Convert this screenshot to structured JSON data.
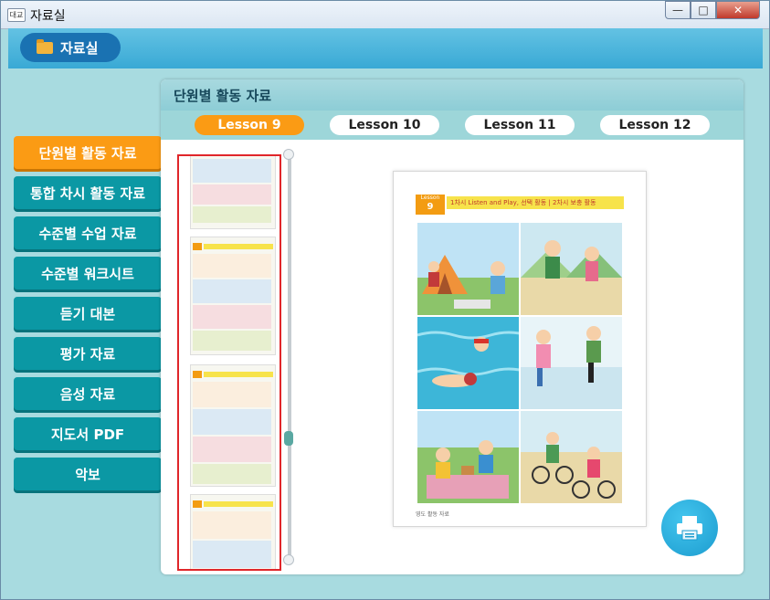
{
  "window": {
    "title": "자료실",
    "app_icon_text": "대교"
  },
  "appbar": {
    "label": "자료실",
    "icon": "folder-icon"
  },
  "sidebar": {
    "items": [
      {
        "label": "단원별 활동 자료",
        "active": true
      },
      {
        "label": "통합 차시 활동 자료",
        "active": false
      },
      {
        "label": "수준별 수업 자료",
        "active": false
      },
      {
        "label": "수준별 워크시트",
        "active": false
      },
      {
        "label": "듣기 대본",
        "active": false
      },
      {
        "label": "평가 자료",
        "active": false
      },
      {
        "label": "음성 자료",
        "active": false
      },
      {
        "label": "지도서 PDF",
        "active": false
      },
      {
        "label": "악보",
        "active": false
      }
    ]
  },
  "panel": {
    "title": "단원별 활동 자료",
    "tabs": [
      {
        "label": "Lesson 9",
        "active": true
      },
      {
        "label": "Lesson 10",
        "active": false
      },
      {
        "label": "Lesson 11",
        "active": false
      },
      {
        "label": "Lesson 12",
        "active": false
      }
    ]
  },
  "preview": {
    "lesson_label": "Lesson",
    "lesson_number": "9",
    "header_text": "1차시 Listen and Play, 선택 활동 | 2차시 보충 활동",
    "footer_text": "영도 활동 자료"
  },
  "colors": {
    "accent_orange": "#fb9b14",
    "sidebar_teal": "#0b98a4",
    "highlight_red": "#e0262a",
    "header_teal": "#9dd6d9"
  },
  "icons": [
    "folder-icon",
    "printer-icon",
    "minimize-icon",
    "maximize-icon",
    "close-icon"
  ]
}
